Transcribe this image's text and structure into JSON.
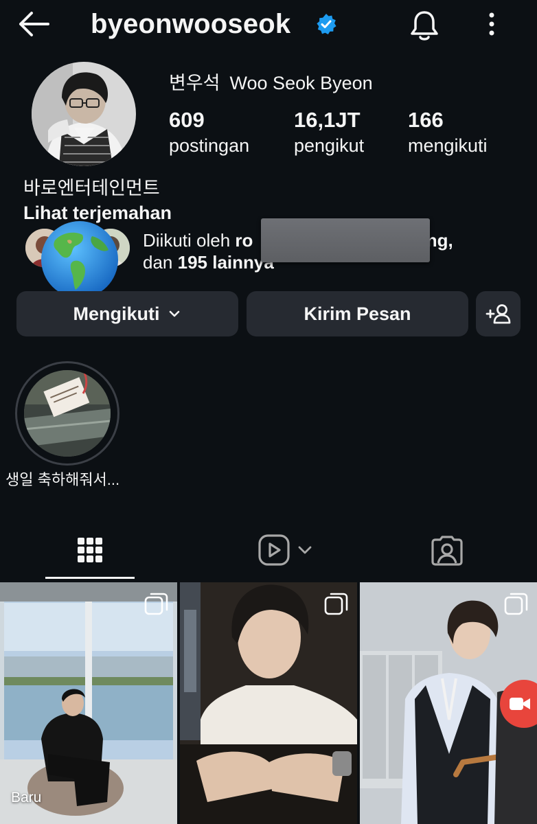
{
  "header": {
    "username": "byeonwooseok",
    "verified": true,
    "icons": {
      "back": "arrow-left-icon",
      "verified": "verified-badge-icon",
      "notifications": "bell-icon",
      "more": "more-vertical-icon"
    }
  },
  "profile": {
    "name_korean": "변우석",
    "name_latin": "Woo Seok Byeon",
    "stats": {
      "posts": {
        "value": "609",
        "label": "postingan"
      },
      "followers": {
        "value": "16,1JT",
        "label": "pengikut"
      },
      "following": {
        "value": "166",
        "label": "mengikuti"
      }
    },
    "bio_company": "바로엔터테인먼트",
    "bio_translate": "Lihat terjemahan",
    "followed_by": {
      "prefix": "Diikuti oleh",
      "name_start": "ro",
      "name_end": "ming,",
      "and": "dan",
      "others": "195 lainnya"
    }
  },
  "actions": {
    "following_label": "Mengikuti",
    "message_label": "Kirim Pesan",
    "icons": {
      "following_chevron": "chevron-down-icon",
      "add_user": "add-user-icon"
    }
  },
  "highlights": [
    {
      "label": "생일 축하해줘서..."
    }
  ],
  "tabs": {
    "items": [
      "grid-icon",
      "reels-icon",
      "tagged-icon"
    ],
    "active": 0
  },
  "posts": {
    "cells": [
      {
        "badge": "Baru",
        "multi": true
      },
      {
        "multi": true
      },
      {
        "multi": true
      }
    ],
    "floating_button": "video-record-icon"
  },
  "colors": {
    "background": "#0c1014",
    "button": "#262a31",
    "verified": "#1d9bf0",
    "record": "#e8453c"
  }
}
